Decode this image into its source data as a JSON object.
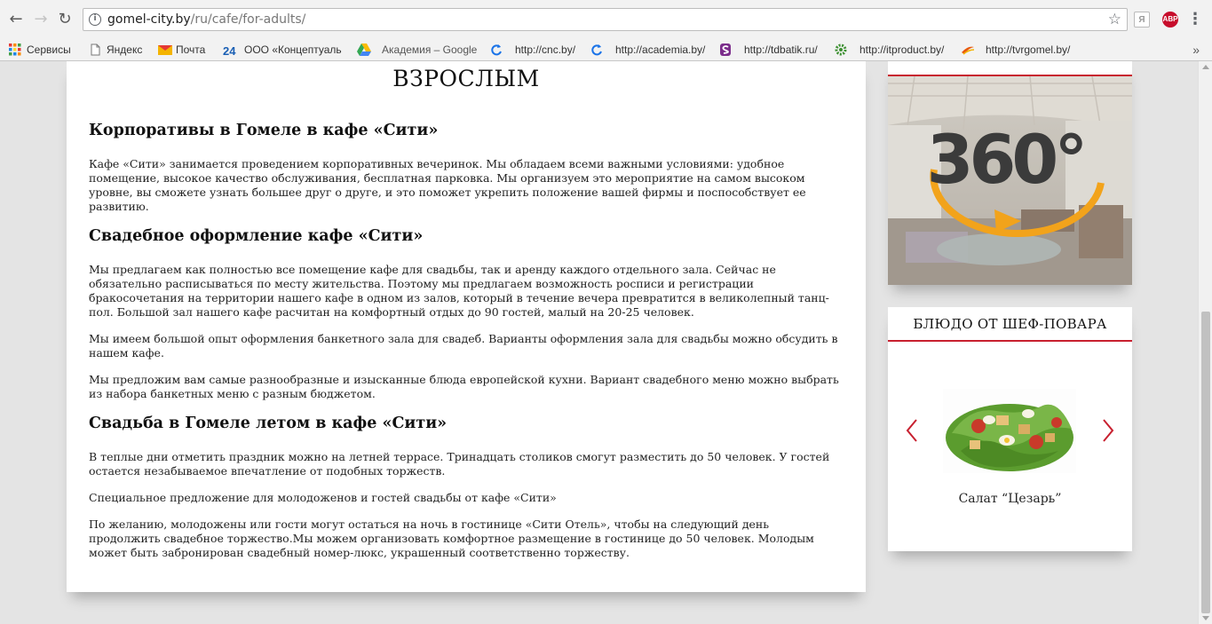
{
  "browser": {
    "url_host": "gomel-city.by",
    "url_path": "/ru/cafe/for-adults/",
    "extensions": {
      "yandex_label": "Я",
      "abp_label": "ABP"
    },
    "bookmarks": [
      {
        "label": "Сервисы",
        "icon": "apps-grid-icon"
      },
      {
        "label": "Яндекс",
        "icon": "page-icon"
      },
      {
        "label": "Почта",
        "icon": "mail-icon"
      },
      {
        "label": "ООО «Концептуаль",
        "icon": "number-24-icon"
      },
      {
        "label": "Академия – Google",
        "icon": "google-drive-icon"
      },
      {
        "label": "http://cnc.by/",
        "icon": "refresh-logo-icon"
      },
      {
        "label": "http://academia.by/",
        "icon": "refresh-logo-icon"
      },
      {
        "label": "http://tdbatik.ru/",
        "icon": "s-logo-icon"
      },
      {
        "label": "http://itproduct.by/",
        "icon": "gear-logo-icon"
      },
      {
        "label": "http://tvrgomel.by/",
        "icon": "swoosh-logo-icon"
      }
    ],
    "more_label": "»"
  },
  "page": {
    "title": "ВЗРОСЛЫМ",
    "sections": [
      {
        "heading": "Корпоративы в Гомеле в кафе «Сити»",
        "paragraphs": [
          "Кафе «Сити» занимается проведением корпоративных вечеринок. Мы обладаем всеми важными условиями: удобное помещение, высокое качество обслуживания, бесплатная парковка. Мы организуем это мероприятие на самом высоком уровне, вы сможете узнать большее друг о друге, и это поможет укрепить положение вашей фирмы и поспособствует ее развитию."
        ]
      },
      {
        "heading": "Свадебное оформление кафе «Сити»",
        "paragraphs": [
          "Мы предлагаем как полностью все помещение кафе для свадьбы, так и аренду каждого отдельного зала. Сейчас не обязательно расписываться по месту жительства. Поэтому мы предлагаем возможность росписи и регистрации бракосочетания на территории нашего кафе в одном из залов, который в течение вечера превратится в великолепный танц-пол. Большой зал нашего кафе расчитан на комфортный отдых до 90 гостей, малый на 20-25 человек.",
          "Мы имеем большой опыт оформления банкетного зала для свадеб. Варианты оформления зала для свадьбы можно обсудить в нашем кафе.",
          "Мы предложим вам самые разнообразные и изысканные блюда европейской кухни. Вариант свадебного меню можно выбрать из набора банкетных меню с разным бюджетом."
        ]
      },
      {
        "heading": "Свадьба в Гомеле летом в кафе «Сити»",
        "paragraphs": [
          "В теплые дни отметить праздник можно на летней террасе. Тринадцать столиков смогут разместить до 50 человек. У гостей остается незабываемое впечатление от подобных торжеств.",
          "Специальное предложение для молодоженов и гостей свадьбы от кафе «Сити»",
          "По желанию, молодожены или гости могут остаться на ночь в гостинице «Сити Отель», чтобы на следующий день продолжить свадебное торжество.Мы можем организовать комфортное размещение в гостинице до 50 человек. Молодым может быть забронирован свадебный номер-люкс, украшенный соответственно торжеству."
        ]
      }
    ]
  },
  "sidebar": {
    "panorama_label": "360°",
    "chef_dish": {
      "header": "БЛЮДО ОТ ШЕФ-ПОВАРА",
      "dish_name": "Салат “Цезарь”"
    }
  },
  "colors": {
    "accent_red": "#c8202f",
    "panorama_orange": "#f2a31b"
  }
}
